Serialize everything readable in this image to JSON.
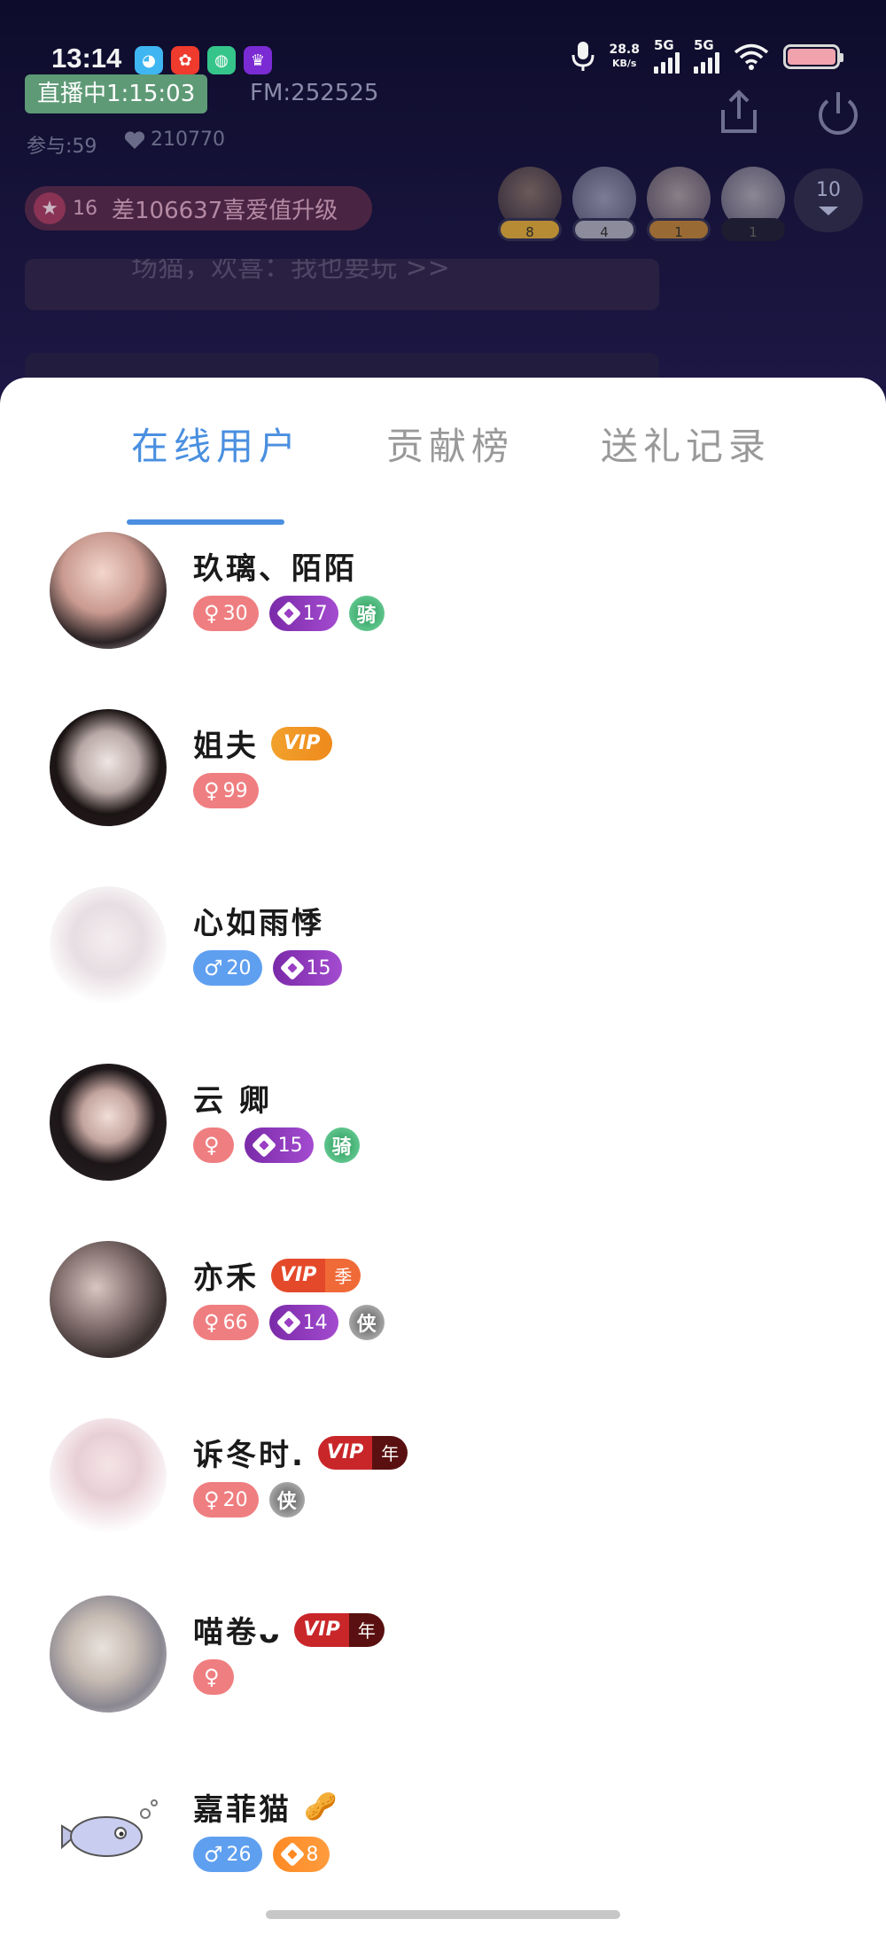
{
  "status_bar": {
    "time": "13:14",
    "net_speed_value": "28.8",
    "net_speed_unit": "KB/s",
    "signal_1": "5G",
    "signal_2": "5G",
    "app_icons": [
      "app-icon-blue",
      "app-icon-red",
      "app-icon-green",
      "app-icon-purple"
    ]
  },
  "room": {
    "live_label": "直播中1:15:03",
    "fm": "FM:252525",
    "participants": "参与:59",
    "hearts": "210770",
    "level": "16",
    "level_text": "差106637喜爱值升级",
    "online_count": "10",
    "top_rank_labels": [
      "8",
      "4",
      "1",
      "1"
    ],
    "chat_preview": "场猫，欢喜：我也要玩 >>"
  },
  "sheet": {
    "tabs": [
      {
        "label": "在线用户",
        "active": true
      },
      {
        "label": "贡献榜",
        "active": false
      },
      {
        "label": "送礼记录",
        "active": false
      }
    ]
  },
  "users": [
    {
      "name": "玖璃、陌陌",
      "gender": "female",
      "gender_level": "30",
      "diamond_level": "17",
      "medal": "骑"
    },
    {
      "name": "姐夫",
      "vip": "VIP",
      "gender": "female",
      "gender_level": "99"
    },
    {
      "name": "心如雨悸",
      "gender": "male",
      "gender_level": "20",
      "diamond_level": "15"
    },
    {
      "name": "云 卿",
      "gender": "female",
      "gender_level": "",
      "diamond_level": "15",
      "medal": "骑"
    },
    {
      "name": "亦禾",
      "vip": "VIP",
      "vip_type": "季",
      "gender": "female",
      "gender_level": "66",
      "diamond_level": "14",
      "medal": "侠"
    },
    {
      "name": "诉冬时.",
      "vip": "VIP",
      "vip_type": "年",
      "gender": "female",
      "gender_level": "20",
      "medal": "侠"
    },
    {
      "name": "喵卷ᴗ",
      "vip": "VIP",
      "vip_type": "年",
      "gender": "female",
      "gender_level": ""
    },
    {
      "name": "嘉菲猫",
      "emoji": "🥜",
      "gender": "male",
      "gender_level": "26",
      "diamond_level": "8"
    }
  ],
  "colors": {
    "accent_blue": "#4a8fe0",
    "female_pink": "#ef7e80",
    "male_blue": "#5f9ff0",
    "diamond_purple": "#9a3fc4",
    "diamond_orange": "#ff8a24",
    "live_green": "#5e9a76"
  }
}
